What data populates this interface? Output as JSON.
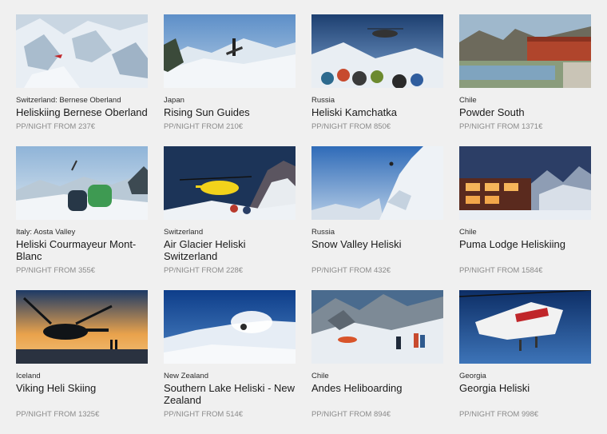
{
  "listings": [
    {
      "region": "Switzerland: Bernese Oberland",
      "title": "Heliskiing Bernese Oberland",
      "price": "PP/NIGHT FROM 237€"
    },
    {
      "region": "Japan",
      "title": "Rising Sun Guides",
      "price": "PP/NIGHT FROM 210€"
    },
    {
      "region": "Russia",
      "title": "Heliski Kamchatka",
      "price": "PP/NIGHT FROM 850€"
    },
    {
      "region": "Chile",
      "title": "Powder South",
      "price": "PP/NIGHT FROM 1371€"
    },
    {
      "region": "Italy: Aosta Valley",
      "title": "Heliski Courmayeur Mont-Blanc",
      "price": "PP/NIGHT FROM 355€"
    },
    {
      "region": "Switzerland",
      "title": "Air Glacier Heliski Switzerland",
      "price": "PP/NIGHT FROM 228€"
    },
    {
      "region": "Russia",
      "title": "Snow Valley Heliski",
      "price": "PP/NIGHT FROM 432€"
    },
    {
      "region": "Chile",
      "title": "Puma Lodge Heliskiing",
      "price": "PP/NIGHT FROM 1584€"
    },
    {
      "region": "Iceland",
      "title": "Viking Heli Skiing",
      "price": "PP/NIGHT FROM 1325€"
    },
    {
      "region": "New Zealand",
      "title": "Southern Lake Heliski - New Zealand",
      "price": "PP/NIGHT FROM 514€"
    },
    {
      "region": "Chile",
      "title": "Andes Heliboarding",
      "price": "PP/NIGHT FROM 894€"
    },
    {
      "region": "Georgia",
      "title": "Georgia Heliski",
      "price": "PP/NIGHT FROM 998€"
    }
  ]
}
